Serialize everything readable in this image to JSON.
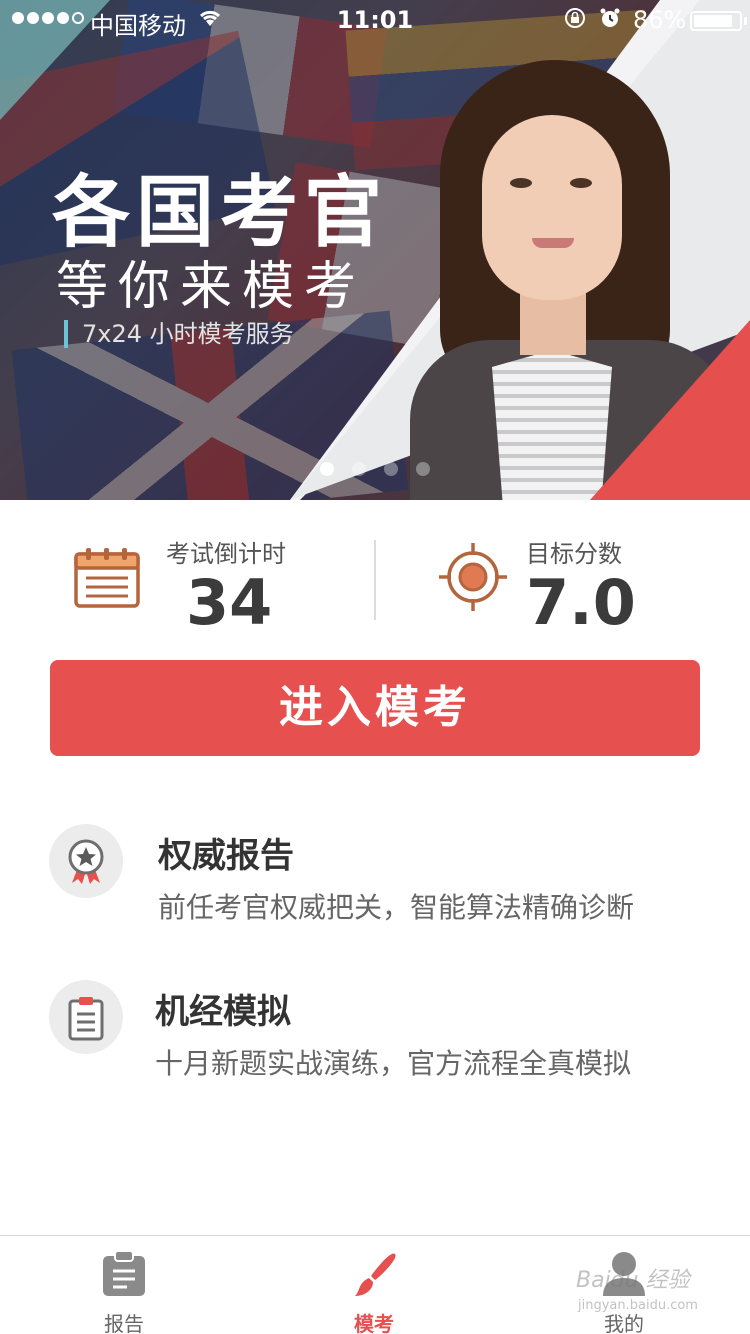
{
  "status_bar": {
    "carrier": "中国移动",
    "time": "11:01",
    "battery_percent_label": "86%",
    "battery_level": 0.86,
    "icons": [
      "signal-dots-icon",
      "wifi-icon",
      "rotation-lock-icon",
      "alarm-icon",
      "battery-icon"
    ]
  },
  "banner": {
    "title": "各国考官",
    "subtitle": "等你来模考",
    "tagline": "7x24 小时模考服务",
    "page_count": 4,
    "active_page": 1
  },
  "stats": {
    "countdown_label": "考试倒计时",
    "countdown_value": "34",
    "target_label": "目标分数",
    "target_value": "7.0",
    "icons": [
      "calendar-icon",
      "target-icon"
    ]
  },
  "cta": {
    "label": "进入模考"
  },
  "features": [
    {
      "title": "权威报告",
      "desc": "前任考官权威把关，智能算法精确诊断",
      "icon": "award-badge-icon"
    },
    {
      "title": "机经模拟",
      "desc": "十月新题实战演练，官方流程全真模拟",
      "icon": "clipboard-icon"
    }
  ],
  "tabbar": {
    "tabs": [
      {
        "label": "报告",
        "icon": "report-clipboard-icon",
        "active": false
      },
      {
        "label": "模考",
        "icon": "paintbrush-icon",
        "active": true
      },
      {
        "label": "我的",
        "icon": "profile-icon",
        "active": false
      }
    ]
  },
  "watermark": {
    "text": "Baidu 经验",
    "sub": "jingyan.baidu.com"
  },
  "colors": {
    "accent": "#e6504f",
    "icon_brown": "#b5653d",
    "text_dark": "#333333",
    "text_muted": "#666666"
  }
}
